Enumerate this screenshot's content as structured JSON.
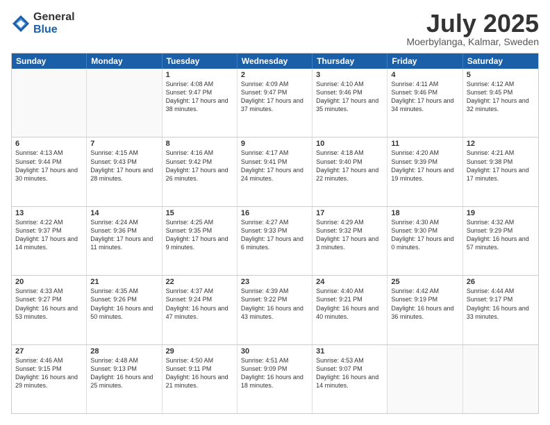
{
  "logo": {
    "general": "General",
    "blue": "Blue"
  },
  "title": {
    "month_year": "July 2025",
    "location": "Moerbylanga, Kalmar, Sweden"
  },
  "header_days": [
    "Sunday",
    "Monday",
    "Tuesday",
    "Wednesday",
    "Thursday",
    "Friday",
    "Saturday"
  ],
  "weeks": [
    [
      {
        "day": "",
        "empty": true
      },
      {
        "day": "",
        "empty": true
      },
      {
        "day": "1",
        "sunrise": "Sunrise: 4:08 AM",
        "sunset": "Sunset: 9:47 PM",
        "daylight": "Daylight: 17 hours and 38 minutes."
      },
      {
        "day": "2",
        "sunrise": "Sunrise: 4:09 AM",
        "sunset": "Sunset: 9:47 PM",
        "daylight": "Daylight: 17 hours and 37 minutes."
      },
      {
        "day": "3",
        "sunrise": "Sunrise: 4:10 AM",
        "sunset": "Sunset: 9:46 PM",
        "daylight": "Daylight: 17 hours and 35 minutes."
      },
      {
        "day": "4",
        "sunrise": "Sunrise: 4:11 AM",
        "sunset": "Sunset: 9:46 PM",
        "daylight": "Daylight: 17 hours and 34 minutes."
      },
      {
        "day": "5",
        "sunrise": "Sunrise: 4:12 AM",
        "sunset": "Sunset: 9:45 PM",
        "daylight": "Daylight: 17 hours and 32 minutes."
      }
    ],
    [
      {
        "day": "6",
        "sunrise": "Sunrise: 4:13 AM",
        "sunset": "Sunset: 9:44 PM",
        "daylight": "Daylight: 17 hours and 30 minutes."
      },
      {
        "day": "7",
        "sunrise": "Sunrise: 4:15 AM",
        "sunset": "Sunset: 9:43 PM",
        "daylight": "Daylight: 17 hours and 28 minutes."
      },
      {
        "day": "8",
        "sunrise": "Sunrise: 4:16 AM",
        "sunset": "Sunset: 9:42 PM",
        "daylight": "Daylight: 17 hours and 26 minutes."
      },
      {
        "day": "9",
        "sunrise": "Sunrise: 4:17 AM",
        "sunset": "Sunset: 9:41 PM",
        "daylight": "Daylight: 17 hours and 24 minutes."
      },
      {
        "day": "10",
        "sunrise": "Sunrise: 4:18 AM",
        "sunset": "Sunset: 9:40 PM",
        "daylight": "Daylight: 17 hours and 22 minutes."
      },
      {
        "day": "11",
        "sunrise": "Sunrise: 4:20 AM",
        "sunset": "Sunset: 9:39 PM",
        "daylight": "Daylight: 17 hours and 19 minutes."
      },
      {
        "day": "12",
        "sunrise": "Sunrise: 4:21 AM",
        "sunset": "Sunset: 9:38 PM",
        "daylight": "Daylight: 17 hours and 17 minutes."
      }
    ],
    [
      {
        "day": "13",
        "sunrise": "Sunrise: 4:22 AM",
        "sunset": "Sunset: 9:37 PM",
        "daylight": "Daylight: 17 hours and 14 minutes."
      },
      {
        "day": "14",
        "sunrise": "Sunrise: 4:24 AM",
        "sunset": "Sunset: 9:36 PM",
        "daylight": "Daylight: 17 hours and 11 minutes."
      },
      {
        "day": "15",
        "sunrise": "Sunrise: 4:25 AM",
        "sunset": "Sunset: 9:35 PM",
        "daylight": "Daylight: 17 hours and 9 minutes."
      },
      {
        "day": "16",
        "sunrise": "Sunrise: 4:27 AM",
        "sunset": "Sunset: 9:33 PM",
        "daylight": "Daylight: 17 hours and 6 minutes."
      },
      {
        "day": "17",
        "sunrise": "Sunrise: 4:29 AM",
        "sunset": "Sunset: 9:32 PM",
        "daylight": "Daylight: 17 hours and 3 minutes."
      },
      {
        "day": "18",
        "sunrise": "Sunrise: 4:30 AM",
        "sunset": "Sunset: 9:30 PM",
        "daylight": "Daylight: 17 hours and 0 minutes."
      },
      {
        "day": "19",
        "sunrise": "Sunrise: 4:32 AM",
        "sunset": "Sunset: 9:29 PM",
        "daylight": "Daylight: 16 hours and 57 minutes."
      }
    ],
    [
      {
        "day": "20",
        "sunrise": "Sunrise: 4:33 AM",
        "sunset": "Sunset: 9:27 PM",
        "daylight": "Daylight: 16 hours and 53 minutes."
      },
      {
        "day": "21",
        "sunrise": "Sunrise: 4:35 AM",
        "sunset": "Sunset: 9:26 PM",
        "daylight": "Daylight: 16 hours and 50 minutes."
      },
      {
        "day": "22",
        "sunrise": "Sunrise: 4:37 AM",
        "sunset": "Sunset: 9:24 PM",
        "daylight": "Daylight: 16 hours and 47 minutes."
      },
      {
        "day": "23",
        "sunrise": "Sunrise: 4:39 AM",
        "sunset": "Sunset: 9:22 PM",
        "daylight": "Daylight: 16 hours and 43 minutes."
      },
      {
        "day": "24",
        "sunrise": "Sunrise: 4:40 AM",
        "sunset": "Sunset: 9:21 PM",
        "daylight": "Daylight: 16 hours and 40 minutes."
      },
      {
        "day": "25",
        "sunrise": "Sunrise: 4:42 AM",
        "sunset": "Sunset: 9:19 PM",
        "daylight": "Daylight: 16 hours and 36 minutes."
      },
      {
        "day": "26",
        "sunrise": "Sunrise: 4:44 AM",
        "sunset": "Sunset: 9:17 PM",
        "daylight": "Daylight: 16 hours and 33 minutes."
      }
    ],
    [
      {
        "day": "27",
        "sunrise": "Sunrise: 4:46 AM",
        "sunset": "Sunset: 9:15 PM",
        "daylight": "Daylight: 16 hours and 29 minutes."
      },
      {
        "day": "28",
        "sunrise": "Sunrise: 4:48 AM",
        "sunset": "Sunset: 9:13 PM",
        "daylight": "Daylight: 16 hours and 25 minutes."
      },
      {
        "day": "29",
        "sunrise": "Sunrise: 4:50 AM",
        "sunset": "Sunset: 9:11 PM",
        "daylight": "Daylight: 16 hours and 21 minutes."
      },
      {
        "day": "30",
        "sunrise": "Sunrise: 4:51 AM",
        "sunset": "Sunset: 9:09 PM",
        "daylight": "Daylight: 16 hours and 18 minutes."
      },
      {
        "day": "31",
        "sunrise": "Sunrise: 4:53 AM",
        "sunset": "Sunset: 9:07 PM",
        "daylight": "Daylight: 16 hours and 14 minutes."
      },
      {
        "day": "",
        "empty": true
      },
      {
        "day": "",
        "empty": true
      }
    ]
  ]
}
